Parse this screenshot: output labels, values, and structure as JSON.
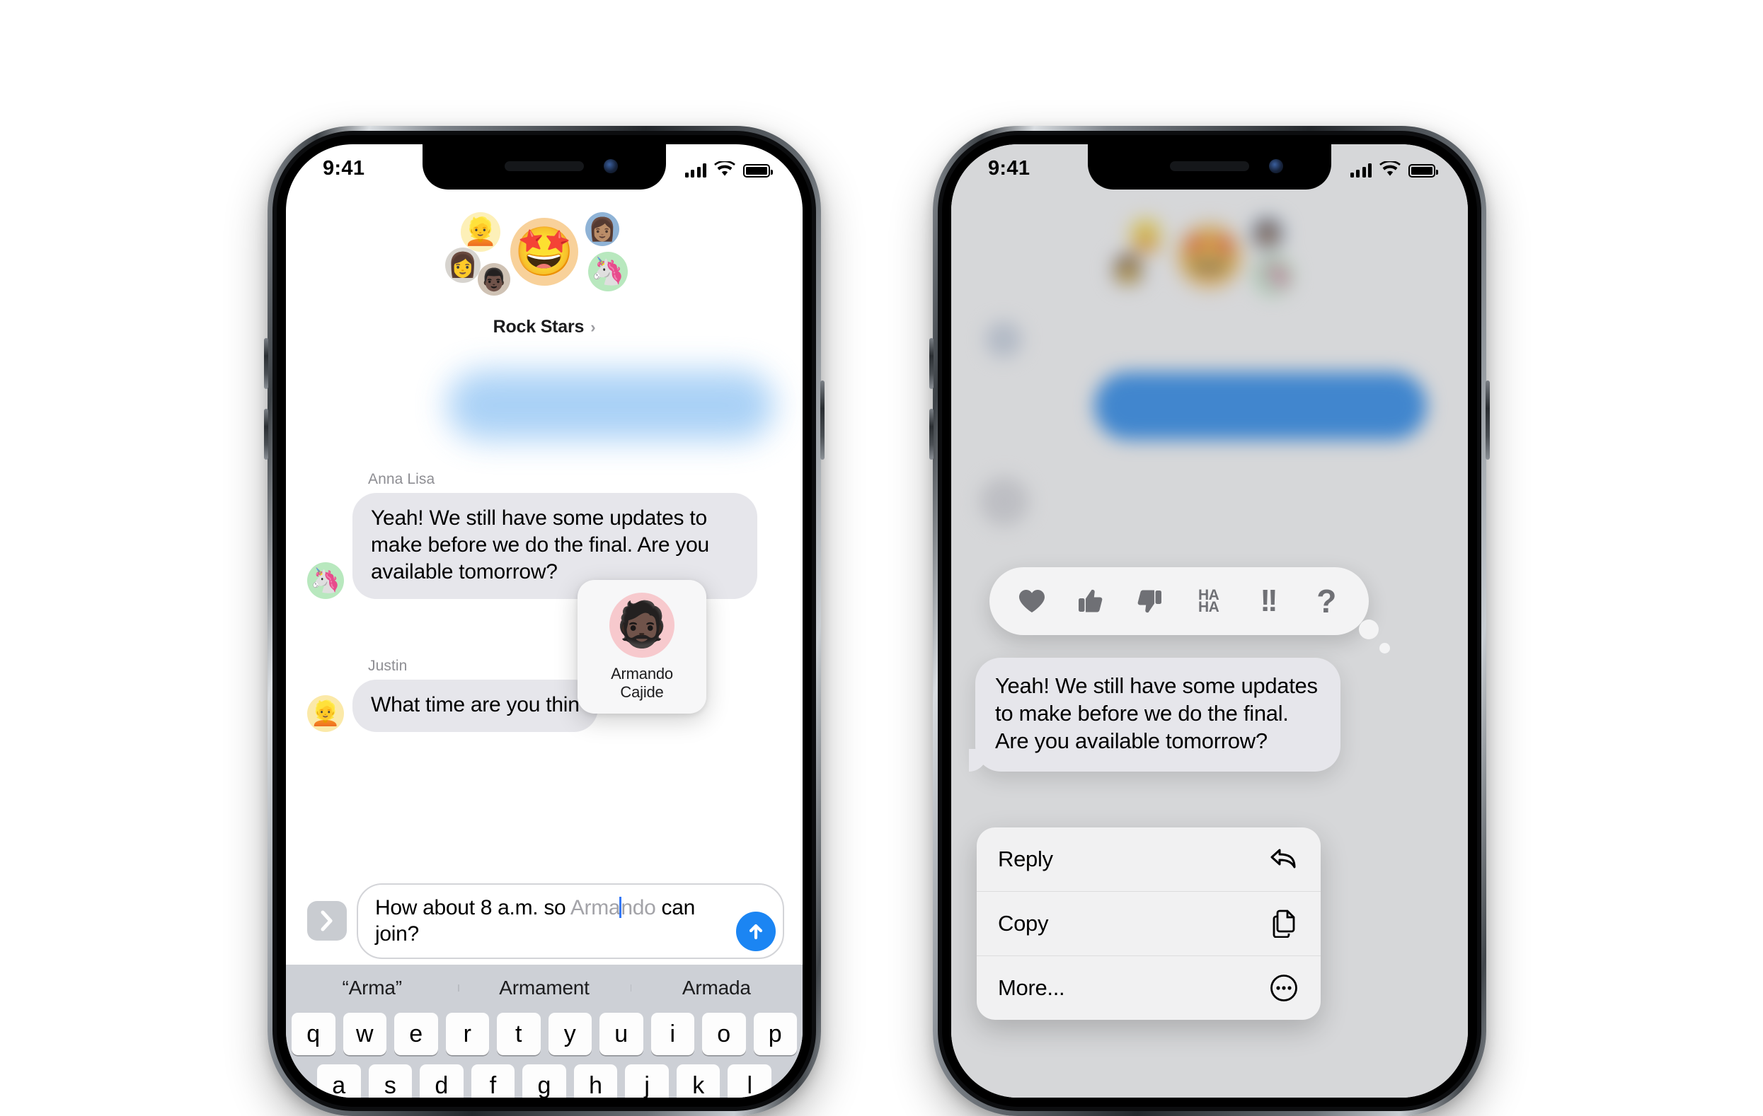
{
  "left_phone": {
    "status": {
      "time": "9:41",
      "signal_icon": "cellular-bars-icon",
      "wifi_icon": "wifi-icon",
      "battery_icon": "battery-icon"
    },
    "group": {
      "name": "Rock Stars",
      "chevron": "›",
      "avatars": [
        {
          "name": "avatar-blonde-memoji",
          "glyph": "👱",
          "bg": "#fdf0b8"
        },
        {
          "name": "avatar-woman-memoji",
          "glyph": "👩",
          "bg": "#d7d4cf"
        },
        {
          "name": "avatar-curly-memoji",
          "glyph": "👨🏿",
          "bg": "#cfc2b4"
        },
        {
          "name": "avatar-star-struck-emoji",
          "glyph": "🤩",
          "bg": "#f8d19a"
        },
        {
          "name": "avatar-woman-photo",
          "glyph": "👩🏽",
          "bg": "#8fb3d6"
        },
        {
          "name": "avatar-unicorn-memoji",
          "glyph": "🦄",
          "bg": "#b8e8be"
        }
      ]
    },
    "messages": [
      {
        "sender": "Anna Lisa",
        "text": "Yeah! We still have some updates to make before we do the final. Are you available tomorrow?",
        "avatar_glyph": "🦄",
        "avatar_bg": "#b8e8be"
      },
      {
        "sender": "Justin",
        "text": "What time are you thin",
        "avatar_glyph": "👱",
        "avatar_bg": "#fbe9a8"
      }
    ],
    "mention_popup": {
      "first_name": "Armando",
      "last_name": "Cajide",
      "avatar_glyph": "🧔🏿",
      "avatar_bg": "#f7c9cd"
    },
    "input": {
      "typed_before": "How about 8 a.m. so ",
      "ghost_head": "Arma",
      "ghost_tail": "ndo",
      "typed_after": " can join?",
      "expand_icon": "chevron-right-icon",
      "send_icon": "send-arrow-up-icon"
    },
    "keyboard": {
      "predictions": [
        "“Arma”",
        "Armament",
        "Armada"
      ],
      "row1": [
        "q",
        "w",
        "e",
        "r",
        "t",
        "y",
        "u",
        "i",
        "o",
        "p"
      ],
      "row2": [
        "a",
        "s",
        "d",
        "f",
        "g",
        "h",
        "j",
        "k",
        "l"
      ]
    }
  },
  "right_phone": {
    "status": {
      "time": "9:41",
      "signal_icon": "cellular-bars-icon",
      "wifi_icon": "wifi-icon",
      "battery_icon": "battery-icon"
    },
    "tapbacks": [
      {
        "name": "tapback-heart",
        "label": "♥"
      },
      {
        "name": "tapback-thumbs-up",
        "label": "👍"
      },
      {
        "name": "tapback-thumbs-down",
        "label": "👎"
      },
      {
        "name": "tapback-haha",
        "label": "HA HA"
      },
      {
        "name": "tapback-exclamation",
        "label": "!!"
      },
      {
        "name": "tapback-question",
        "label": "?"
      }
    ],
    "focused_message": "Yeah! We still have some updates to make before we do the final. Are you available tomorrow?",
    "context_menu": [
      {
        "label": "Reply",
        "icon": "reply-arrow-icon"
      },
      {
        "label": "Copy",
        "icon": "copy-documents-icon"
      },
      {
        "label": "More...",
        "icon": "ellipsis-circle-icon"
      }
    ]
  },
  "colors": {
    "accent_blue": "#1b85f3",
    "bubble_grey": "#e6e6eb",
    "caret_blue": "#3478f6"
  }
}
